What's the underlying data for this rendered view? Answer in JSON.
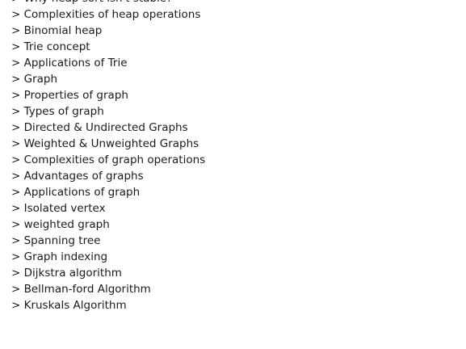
{
  "document": {
    "items": [
      "> Why heap sort isn't stable?",
      "> Complexities of heap operations",
      "> Binomial heap",
      "> Trie concept",
      "> Applications of Trie",
      "> Graph",
      "> Properties of graph",
      "> Types of graph",
      "> Directed & Undirected Graphs",
      "> Weighted & Unweighted Graphs",
      "> Complexities of graph operations",
      "> Advantages of graphs",
      "> Applications of graph",
      "> Isolated vertex",
      "> weighted graph",
      "> Spanning tree",
      "> Graph indexing",
      "> Dijkstra algorithm",
      "> Bellman-ford Algorithm",
      "> Kruskals Algorithm"
    ]
  }
}
